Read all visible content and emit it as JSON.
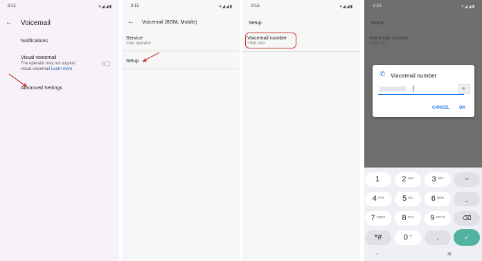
{
  "panel1": {
    "status_time": "8:15",
    "title": "Voicemail",
    "notifications_label": "Notifications",
    "visual_voicemail_title": "Visual voicemail",
    "visual_voicemail_desc_1": "The operator may not support",
    "visual_voicemail_desc_2": "visual voicemail ",
    "learn_more": "Learn more",
    "advanced_settings": "Advanced Settings"
  },
  "panel2": {
    "status_time": "8:15",
    "title": "Voicemail (BSNL Mobile)",
    "service_title": "Service",
    "service_sub": "Your operator",
    "setup_label": "Setup"
  },
  "panel3": {
    "status_time": "8:16",
    "title": "Setup",
    "voicemail_number_title": "Voicemail number",
    "voicemail_number_sub": "<Not set>"
  },
  "panel4": {
    "status_time": "8:16",
    "bg_title": "Setup",
    "bg_row_title": "Voicemail number",
    "bg_row_sub": "<Not set>",
    "dialog_title": "Voicemail number",
    "cancel_label": "CANCEL",
    "ok_label": "OK",
    "keys": [
      {
        "num": "1",
        "letters": ""
      },
      {
        "num": "2",
        "letters": "ABC"
      },
      {
        "num": "3",
        "letters": "DEF"
      },
      {
        "num": "4",
        "letters": "GHI"
      },
      {
        "num": "5",
        "letters": "JKL"
      },
      {
        "num": "6",
        "letters": "MNO"
      },
      {
        "num": "7",
        "letters": "PQRS"
      },
      {
        "num": "8",
        "letters": "TUV"
      },
      {
        "num": "9",
        "letters": "WXYZ"
      },
      {
        "num": "*#",
        "letters": ""
      },
      {
        "num": "0",
        "letters": "+"
      },
      {
        "num": ".",
        "letters": ""
      }
    ],
    "side_keys": [
      "−",
      "⎵",
      "⌫",
      "✓"
    ]
  },
  "colors": {
    "accent": "#1a73e8",
    "annotation": "#c0392b",
    "keypad_confirm": "#54b3a0"
  }
}
